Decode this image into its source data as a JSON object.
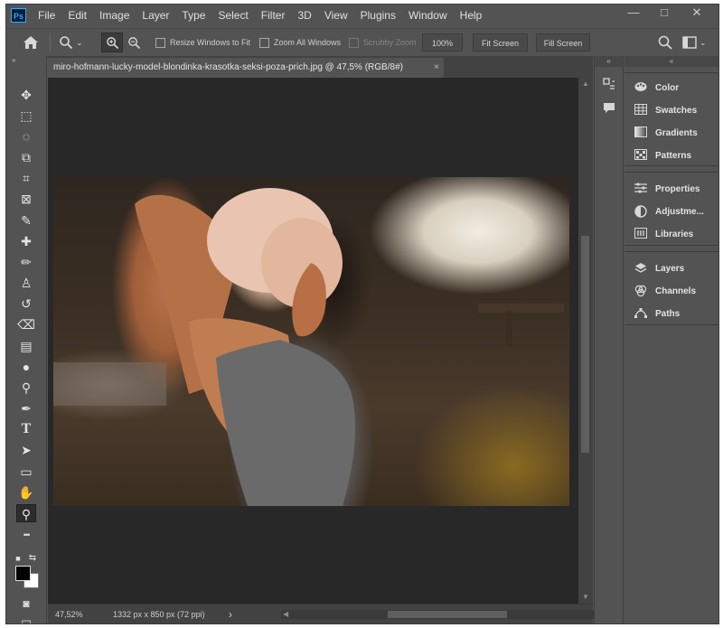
{
  "app": {
    "logo": "Ps"
  },
  "menu": [
    "File",
    "Edit",
    "Image",
    "Layer",
    "Type",
    "Select",
    "Filter",
    "3D",
    "View",
    "Plugins",
    "Window",
    "Help"
  ],
  "window_controls": {
    "minimize": "—",
    "maximize": "□",
    "close": "✕"
  },
  "options": {
    "resize_windows": "Resize Windows to Fit",
    "zoom_all": "Zoom All Windows",
    "scrubby": "Scrubby Zoom",
    "zoom_value": "100%",
    "fit_screen": "Fit Screen",
    "fill_screen": "Fill Screen"
  },
  "document": {
    "tab_title": "miro-hofmann-lucky-model-blondinka-krasotka-seksi-poza-prich.jpg @ 47,5% (RGB/8#)",
    "close": "×"
  },
  "status": {
    "zoom": "47,52%",
    "info": "1332 px x 850 px (72 ppi)",
    "arrow": "›"
  },
  "toolbar": {
    "tools": [
      {
        "name": "move-tool",
        "glyph": "✥"
      },
      {
        "name": "marquee-tool",
        "glyph": "⬚"
      },
      {
        "name": "lasso-tool",
        "glyph": "◌"
      },
      {
        "name": "object-select-tool",
        "glyph": "⧉"
      },
      {
        "name": "crop-tool",
        "glyph": "⌗"
      },
      {
        "name": "frame-tool",
        "glyph": "⊠"
      },
      {
        "name": "eyedropper-tool",
        "glyph": "✎"
      },
      {
        "name": "healing-brush-tool",
        "glyph": "✚"
      },
      {
        "name": "brush-tool",
        "glyph": "✏"
      },
      {
        "name": "clone-stamp-tool",
        "glyph": "♙"
      },
      {
        "name": "history-brush-tool",
        "glyph": "↺"
      },
      {
        "name": "eraser-tool",
        "glyph": "⌫"
      },
      {
        "name": "gradient-tool",
        "glyph": "▤"
      },
      {
        "name": "blur-tool",
        "glyph": "●"
      },
      {
        "name": "dodge-tool",
        "glyph": "⚲"
      },
      {
        "name": "pen-tool",
        "glyph": "✒"
      },
      {
        "name": "type-tool",
        "glyph": "T"
      },
      {
        "name": "path-selection-tool",
        "glyph": "➤"
      },
      {
        "name": "rectangle-tool",
        "glyph": "▭"
      },
      {
        "name": "hand-tool",
        "glyph": "✋"
      },
      {
        "name": "zoom-tool",
        "glyph": "⚲"
      },
      {
        "name": "more-tools",
        "glyph": "•••"
      }
    ]
  },
  "panels": {
    "group1": [
      {
        "icon": "🎨",
        "label": "Color"
      },
      {
        "icon": "▦",
        "label": "Swatches"
      },
      {
        "icon": "▥",
        "label": "Gradients"
      },
      {
        "icon": "▩",
        "label": "Patterns"
      }
    ],
    "group2": [
      {
        "icon": "≡",
        "label": "Properties"
      },
      {
        "icon": "◐",
        "label": "Adjustme..."
      },
      {
        "icon": "▤",
        "label": "Libraries"
      }
    ],
    "group3": [
      {
        "icon": "◈",
        "label": "Layers"
      },
      {
        "icon": "⊛",
        "label": "Channels"
      },
      {
        "icon": "⌁",
        "label": "Paths"
      }
    ]
  }
}
